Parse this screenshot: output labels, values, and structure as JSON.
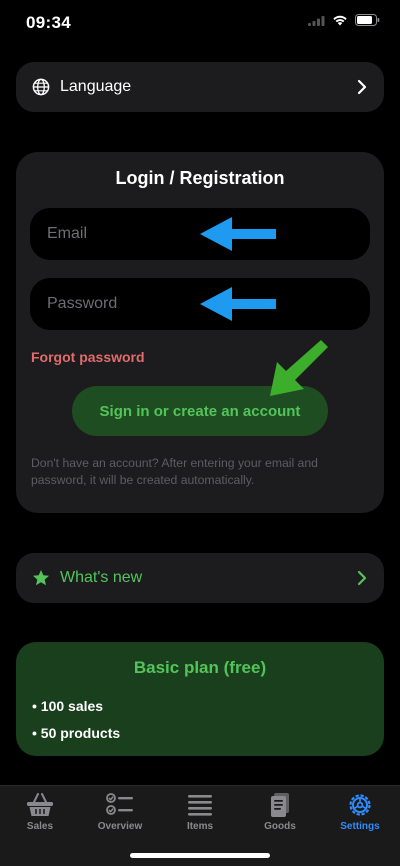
{
  "status_bar": {
    "time": "09:34"
  },
  "language_row": {
    "label": "Language",
    "icon": "globe-icon"
  },
  "login": {
    "title": "Login / Registration",
    "email_placeholder": "Email",
    "password_placeholder": "Password",
    "forgot_label": "Forgot password",
    "signin_label": "Sign in or create an account",
    "hint": "Don't have an account? After entering your email and password, it will be created automatically."
  },
  "whats_new_row": {
    "label": "What's new",
    "icon": "star-icon"
  },
  "plan": {
    "title": "Basic plan (free)",
    "features": [
      "• 100 sales",
      "• 50 products"
    ]
  },
  "tabs": [
    {
      "label": "Sales",
      "icon": "basket-icon",
      "active": false
    },
    {
      "label": "Overview",
      "icon": "checklist-icon",
      "active": false
    },
    {
      "label": "Items",
      "icon": "list-icon",
      "active": false
    },
    {
      "label": "Goods",
      "icon": "document-icon",
      "active": false
    },
    {
      "label": "Settings",
      "icon": "gear-icon",
      "active": true
    }
  ],
  "colors": {
    "accent_green": "#53c45a",
    "accent_blue": "#2f8cff",
    "danger_red": "#e06c6c",
    "annotation_arrow_blue": "#1e9bf0",
    "annotation_arrow_green": "#3dae2b"
  }
}
